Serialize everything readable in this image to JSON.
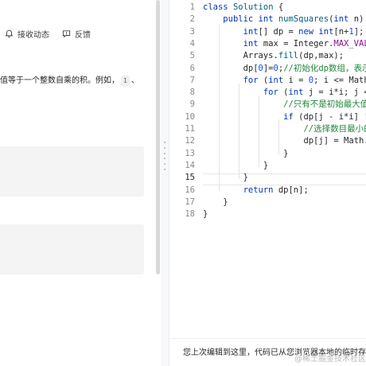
{
  "left": {
    "header": {
      "subscribe_label": "接收动态",
      "feedback_label": "反馈"
    },
    "description": {
      "text_before": "值等于一个整数自乘的积。例如，",
      "chip": "1",
      "text_after": "、"
    }
  },
  "editor": {
    "line_numbers": [
      "1",
      "2",
      "3",
      "4",
      "5",
      "6",
      "7",
      "8",
      "9",
      "10",
      "11",
      "12",
      "13",
      "14",
      "15",
      "16",
      "17",
      "18"
    ],
    "active_line": "15",
    "lines": [
      [
        {
          "t": "class ",
          "c": "kw"
        },
        {
          "t": "Solution",
          "c": "fn"
        },
        {
          "t": " {",
          "c": ""
        }
      ],
      [
        {
          "t": "    ",
          "c": ""
        },
        {
          "t": "public ",
          "c": "kw"
        },
        {
          "t": "int ",
          "c": "ty"
        },
        {
          "t": "numSquares",
          "c": "fn"
        },
        {
          "t": "(",
          "c": ""
        },
        {
          "t": "int ",
          "c": "ty"
        },
        {
          "t": "n) {",
          "c": ""
        }
      ],
      [
        {
          "t": "        ",
          "c": ""
        },
        {
          "t": "int",
          "c": "ty"
        },
        {
          "t": "[] dp = ",
          "c": ""
        },
        {
          "t": "new ",
          "c": "kw"
        },
        {
          "t": "int",
          "c": "ty"
        },
        {
          "t": "[n+",
          "c": ""
        },
        {
          "t": "1",
          "c": "num"
        },
        {
          "t": "];",
          "c": ""
        }
      ],
      [
        {
          "t": "        ",
          "c": ""
        },
        {
          "t": "int ",
          "c": "ty"
        },
        {
          "t": "max = Integer.",
          "c": ""
        },
        {
          "t": "MAX_VALUE",
          "c": "fld"
        },
        {
          "t": ";",
          "c": ""
        }
      ],
      [
        {
          "t": "        ",
          "c": ""
        },
        {
          "t": "Arrays.",
          "c": ""
        },
        {
          "t": "fill",
          "c": "fn"
        },
        {
          "t": "(dp,max);",
          "c": ""
        }
      ],
      [
        {
          "t": "        ",
          "c": ""
        },
        {
          "t": "dp[",
          "c": ""
        },
        {
          "t": "0",
          "c": "num"
        },
        {
          "t": "]=",
          "c": ""
        },
        {
          "t": "0",
          "c": "num"
        },
        {
          "t": ";",
          "c": ""
        },
        {
          "t": "//初始化dp数组，表示当",
          "c": "cmz"
        }
      ],
      [
        {
          "t": "        ",
          "c": ""
        },
        {
          "t": "for ",
          "c": "kw"
        },
        {
          "t": "(",
          "c": ""
        },
        {
          "t": "int ",
          "c": "ty"
        },
        {
          "t": "i = ",
          "c": ""
        },
        {
          "t": "0",
          "c": "num"
        },
        {
          "t": "; i <= Math.",
          "c": ""
        }
      ],
      [
        {
          "t": "            ",
          "c": ""
        },
        {
          "t": "for ",
          "c": "kw"
        },
        {
          "t": "(",
          "c": ""
        },
        {
          "t": "int ",
          "c": "ty"
        },
        {
          "t": "j = i*i; j <=",
          "c": ""
        }
      ],
      [
        {
          "t": "                ",
          "c": ""
        },
        {
          "t": "//只有不是初始最大值时",
          "c": "cmz"
        }
      ],
      [
        {
          "t": "                ",
          "c": ""
        },
        {
          "t": "if ",
          "c": "kw"
        },
        {
          "t": "(dp[j - i*i] !=",
          "c": ""
        }
      ],
      [
        {
          "t": "                    ",
          "c": ""
        },
        {
          "t": "//选择数目最小的",
          "c": "cmz"
        }
      ],
      [
        {
          "t": "                    ",
          "c": ""
        },
        {
          "t": "dp[j] = Math.",
          "c": ""
        },
        {
          "t": "mi",
          "c": "fn"
        }
      ],
      [
        {
          "t": "                ",
          "c": ""
        },
        {
          "t": "}",
          "c": ""
        }
      ],
      [
        {
          "t": "            ",
          "c": ""
        },
        {
          "t": "}",
          "c": ""
        }
      ],
      [
        {
          "t": "        ",
          "c": ""
        },
        {
          "t": "}",
          "c": ""
        }
      ],
      [
        {
          "t": "        ",
          "c": ""
        },
        {
          "t": "return ",
          "c": "kw"
        },
        {
          "t": "dp[n];",
          "c": ""
        }
      ],
      [
        {
          "t": "    ",
          "c": ""
        },
        {
          "t": "}",
          "c": ""
        }
      ],
      [
        {
          "t": "}",
          "c": ""
        }
      ]
    ]
  },
  "status": {
    "text": "您上次编辑到这里，代码已从您浏览器本地的临时存储中"
  },
  "watermark": "@稀土掘金技术社区"
}
